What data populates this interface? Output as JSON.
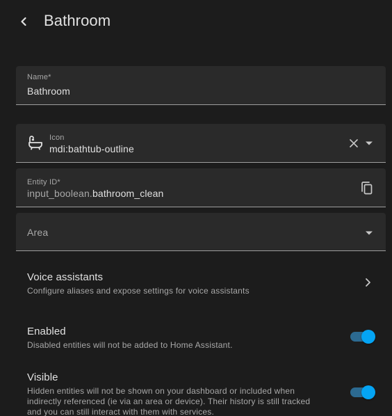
{
  "header": {
    "title": "Bathroom"
  },
  "name_field": {
    "label": "Name*",
    "value": "Bathroom"
  },
  "icon_field": {
    "label": "Icon",
    "value": "mdi:bathtub-outline",
    "icon": "bathtub-outline-icon"
  },
  "entity_field": {
    "label": "Entity ID*",
    "prefix": "input_boolean.",
    "value": "bathroom_clean"
  },
  "area_field": {
    "label": "Area"
  },
  "voice_assistants": {
    "title": "Voice assistants",
    "subtitle": "Configure aliases and expose settings for voice assistants"
  },
  "enabled": {
    "title": "Enabled",
    "subtitle": "Disabled entities will not be added to Home Assistant.",
    "on": true
  },
  "visible": {
    "title": "Visible",
    "subtitle": "Hidden entities will not be shown on your dashboard or included when indirectly referenced (ie via an area or device). Their history is still tracked and you can still interact with them with services.",
    "on": true
  },
  "colors": {
    "accent": "#04a4f4",
    "track": "#2c6a91",
    "background": "#1c1c1c",
    "field": "#2a2a2a"
  }
}
